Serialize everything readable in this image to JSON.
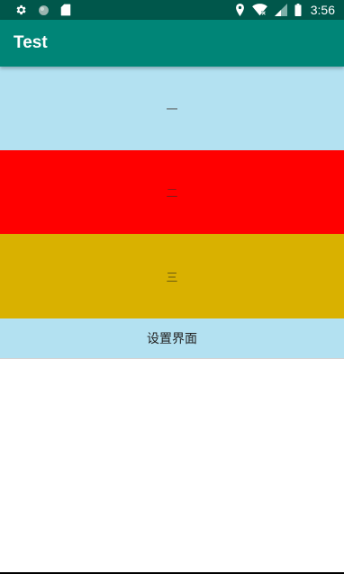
{
  "status_bar": {
    "time": "3:56",
    "left_icons": [
      "settings-gear-icon",
      "circle-notification-icon",
      "sd-card-icon"
    ],
    "right_icons": [
      "location-pin-icon",
      "wifi-x-icon",
      "cell-signal-icon",
      "battery-icon"
    ]
  },
  "app_bar": {
    "title": "Test",
    "color": "#008577"
  },
  "panels": [
    {
      "label": "一",
      "color": "#B3E1F1"
    },
    {
      "label": "二",
      "color": "#FF0000"
    },
    {
      "label": "三",
      "color": "#D9B100"
    }
  ],
  "settings_tab": {
    "label": "设置界面",
    "color": "#B3E1F1"
  }
}
